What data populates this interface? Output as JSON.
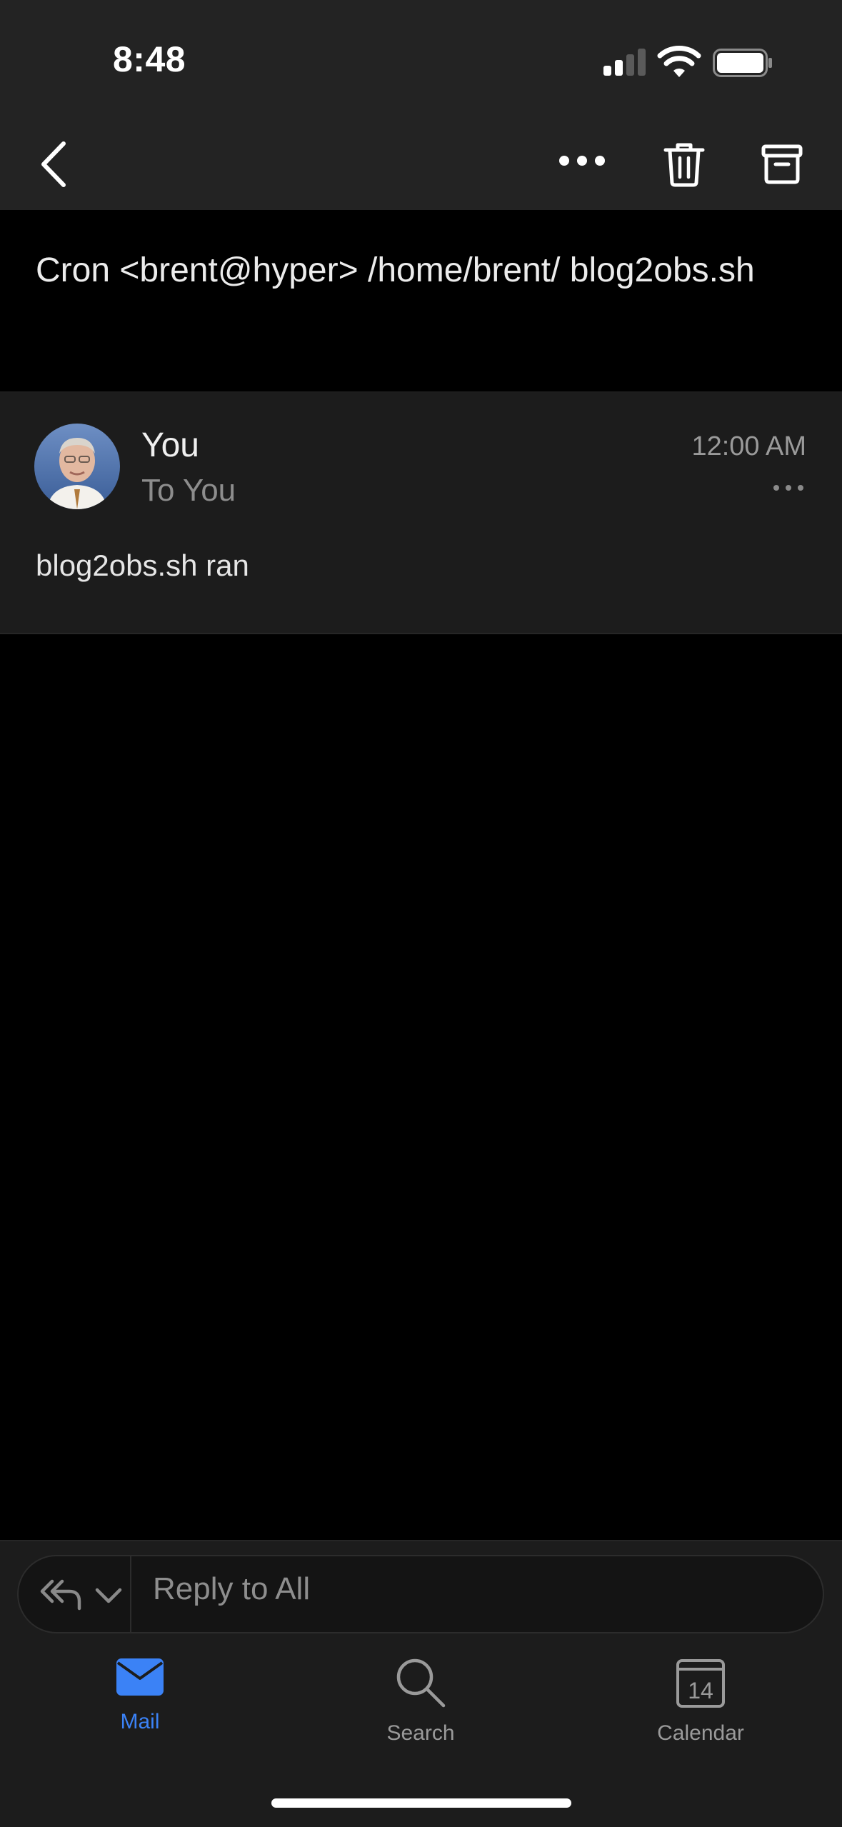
{
  "status_bar": {
    "time": "8:48",
    "icons": [
      "signal-icon",
      "wifi-icon",
      "battery-icon"
    ]
  },
  "toolbar": {
    "buttons": [
      "back-icon",
      "more-icon",
      "trash-icon",
      "archive-icon"
    ]
  },
  "email": {
    "subject": "Cron <brent@hyper> /home/brent/ blog2obs.sh",
    "sender": "You",
    "recipient": "To You",
    "time": "12:00 AM",
    "body": "blog2obs.sh ran"
  },
  "reply": {
    "placeholder": "Reply to All"
  },
  "tabs": [
    {
      "label": "Mail",
      "icon": "mail-icon",
      "active": true
    },
    {
      "label": "Search",
      "icon": "search-icon",
      "active": false
    },
    {
      "label": "Calendar",
      "icon": "calendar-icon",
      "active": false,
      "badge": "14"
    }
  ],
  "colors": {
    "accent": "#3b82f6",
    "toolbar_bg": "#232323",
    "card_bg": "#1c1c1c",
    "inactive_tab": "#9a9a9a"
  }
}
